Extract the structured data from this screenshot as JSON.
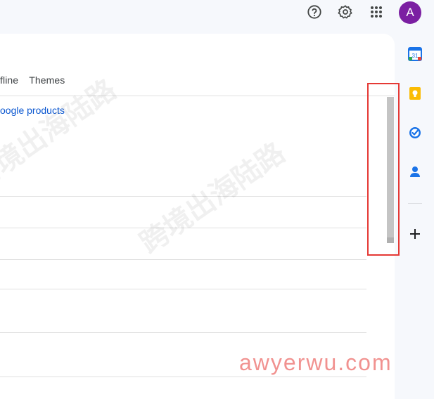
{
  "header": {
    "avatar_letter": "A",
    "help_icon": "help-icon",
    "settings_icon": "gear-icon",
    "apps_icon": "apps-grid-icon"
  },
  "tabs": [
    "fline",
    "Themes"
  ],
  "content": {
    "link_text": "oogle products"
  },
  "side_panel": {
    "calendar_day": "31",
    "items": [
      "calendar-icon",
      "keep-icon",
      "tasks-icon",
      "contacts-icon"
    ],
    "add_icon": "+"
  },
  "watermark": {
    "text": "跨境出海陆路",
    "url": "awyerwu.com"
  },
  "colors": {
    "accent": "#0b57d0",
    "avatar": "#7b1fa2",
    "highlight": "#e53935"
  }
}
